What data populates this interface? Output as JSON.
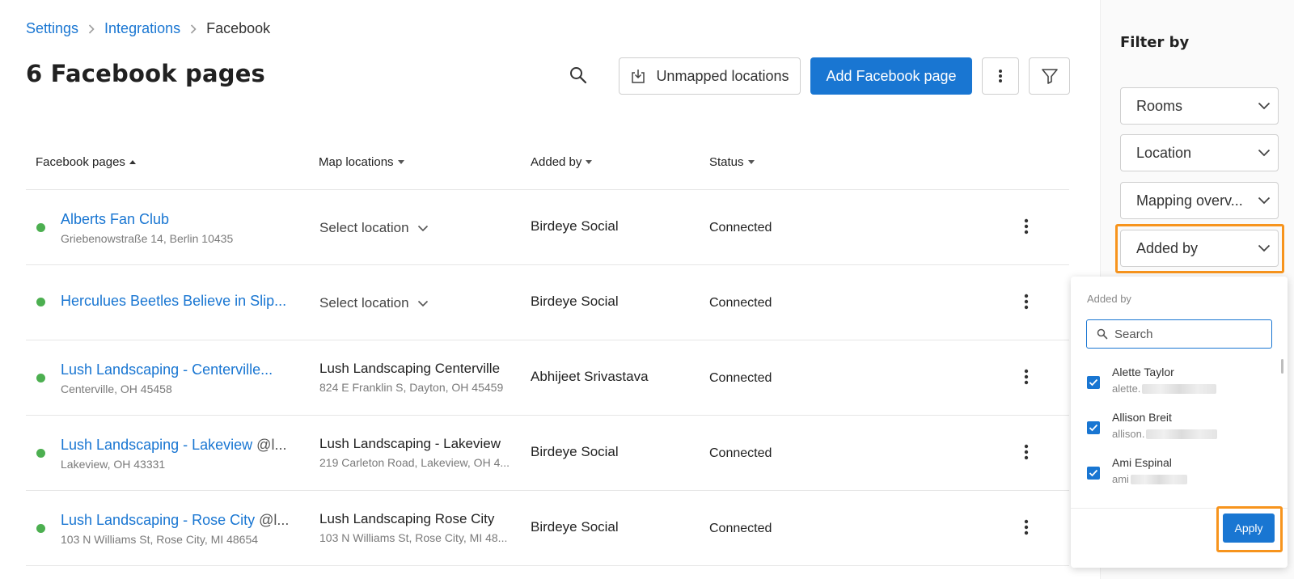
{
  "breadcrumb": {
    "items": [
      "Settings",
      "Integrations"
    ],
    "current": "Facebook"
  },
  "page": {
    "title": "6 Facebook pages"
  },
  "toolbar": {
    "unmapped_label": "Unmapped locations",
    "add_label": "Add Facebook page"
  },
  "table": {
    "columns": [
      "Facebook pages",
      "Map locations",
      "Added by",
      "Status"
    ],
    "rows": [
      {
        "name": "Alberts Fan Club",
        "handle": "",
        "address": "Griebenowstraße 14, Berlin 10435",
        "location_select": "Select location",
        "location_name": "",
        "location_address": "",
        "added_by": "Birdeye Social",
        "status": "Connected"
      },
      {
        "name": "Herculues Beetles Believe in Slip...",
        "handle": "",
        "address": "",
        "location_select": "Select location",
        "location_name": "",
        "location_address": "",
        "added_by": "Birdeye Social",
        "status": "Connected"
      },
      {
        "name": "Lush Landscaping - Centerville...",
        "handle": "",
        "address": "Centerville, OH 45458",
        "location_select": "",
        "location_name": "Lush Landscaping Centerville",
        "location_address": "824 E Franklin S, Dayton, OH 45459",
        "added_by": "Abhijeet Srivastava",
        "status": "Connected"
      },
      {
        "name": "Lush Landscaping - Lakeview",
        "handle": "@l...",
        "address": "Lakeview, OH 43331",
        "location_select": "",
        "location_name": "Lush Landscaping - Lakeview",
        "location_address": "219 Carleton Road, Lakeview, OH 4...",
        "added_by": "Birdeye Social",
        "status": "Connected"
      },
      {
        "name": "Lush Landscaping - Rose City",
        "handle": "@l...",
        "address": "103 N Williams St, Rose City, MI 48654",
        "location_select": "",
        "location_name": "Lush Landscaping Rose City",
        "location_address": "103 N Williams St, Rose City, MI 48...",
        "added_by": "Birdeye Social",
        "status": "Connected"
      }
    ]
  },
  "filters": {
    "title": "Filter by",
    "selects": [
      "Rooms",
      "Location",
      "Mapping overv...",
      "Added by"
    ]
  },
  "dropdown": {
    "header": "Added by",
    "search_placeholder": "Search",
    "items": [
      {
        "name": "Alette Taylor",
        "email_prefix": "alette.",
        "checked": true
      },
      {
        "name": "Allison Breit",
        "email_prefix": "allison.",
        "checked": true
      },
      {
        "name": "Ami Espinal",
        "email_prefix": "ami",
        "checked": true
      }
    ],
    "apply_label": "Apply"
  },
  "colors": {
    "accent": "#1976d2",
    "status_dot": "#4caf50",
    "highlight": "#f7941d"
  }
}
